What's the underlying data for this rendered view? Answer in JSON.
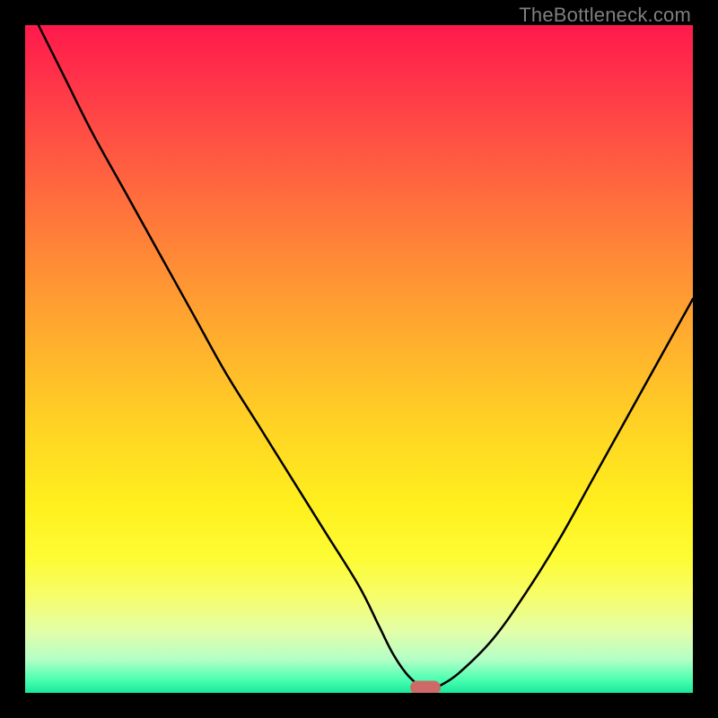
{
  "watermark": "TheBottleneck.com",
  "colors": {
    "frame": "#000000",
    "curve": "#000000",
    "marker": "#cd6a67",
    "watermark": "#7f7f7f"
  },
  "chart_data": {
    "type": "line",
    "title": "",
    "xlabel": "",
    "ylabel": "",
    "xlim": [
      0,
      100
    ],
    "ylim": [
      0,
      100
    ],
    "grid": false,
    "legend": false,
    "series": [
      {
        "name": "bottleneck-curve",
        "x": [
          2,
          6,
          10,
          15,
          20,
          25,
          30,
          35,
          40,
          45,
          50,
          53,
          55,
          57,
          59,
          60,
          62,
          65,
          70,
          75,
          80,
          85,
          90,
          95,
          100
        ],
        "y": [
          100,
          92,
          84,
          75,
          66,
          57,
          48,
          40,
          32,
          24,
          16,
          10,
          6,
          3,
          1,
          0,
          1,
          3,
          8,
          15,
          23,
          32,
          41,
          50,
          59
        ]
      }
    ],
    "marker": {
      "x": 60,
      "y": 0
    }
  }
}
